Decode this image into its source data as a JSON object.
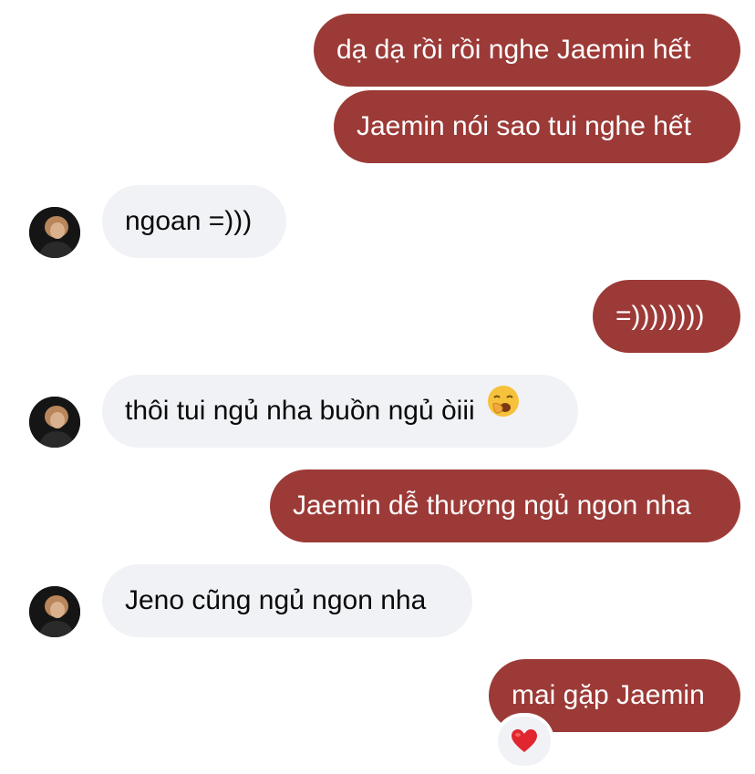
{
  "chat": {
    "messages": [
      {
        "direction": "outgoing",
        "text": "dạ dạ rồi rồi nghe Jaemin hết"
      },
      {
        "direction": "outgoing",
        "text": "Jaemin nói sao tui nghe hết"
      },
      {
        "direction": "incoming",
        "text": "ngoan =)))",
        "avatar": "avatar-photo"
      },
      {
        "direction": "outgoing",
        "text": "=))))))))"
      },
      {
        "direction": "incoming",
        "text": "thôi tui ngủ nha buồn ngủ òiii",
        "emoji": "yawning-face-icon",
        "avatar": "avatar-photo"
      },
      {
        "direction": "outgoing",
        "text": "Jaemin dễ thương ngủ ngon nha"
      },
      {
        "direction": "incoming",
        "text": "Jeno cũng ngủ ngon nha",
        "avatar": "avatar-photo"
      },
      {
        "direction": "outgoing",
        "text": "mai gặp Jaemin",
        "reaction": "red-heart-icon"
      }
    ]
  },
  "colors": {
    "outgoing_bubble": "#9c3a37",
    "incoming_bubble": "#f1f2f6",
    "background": "#ffffff"
  }
}
